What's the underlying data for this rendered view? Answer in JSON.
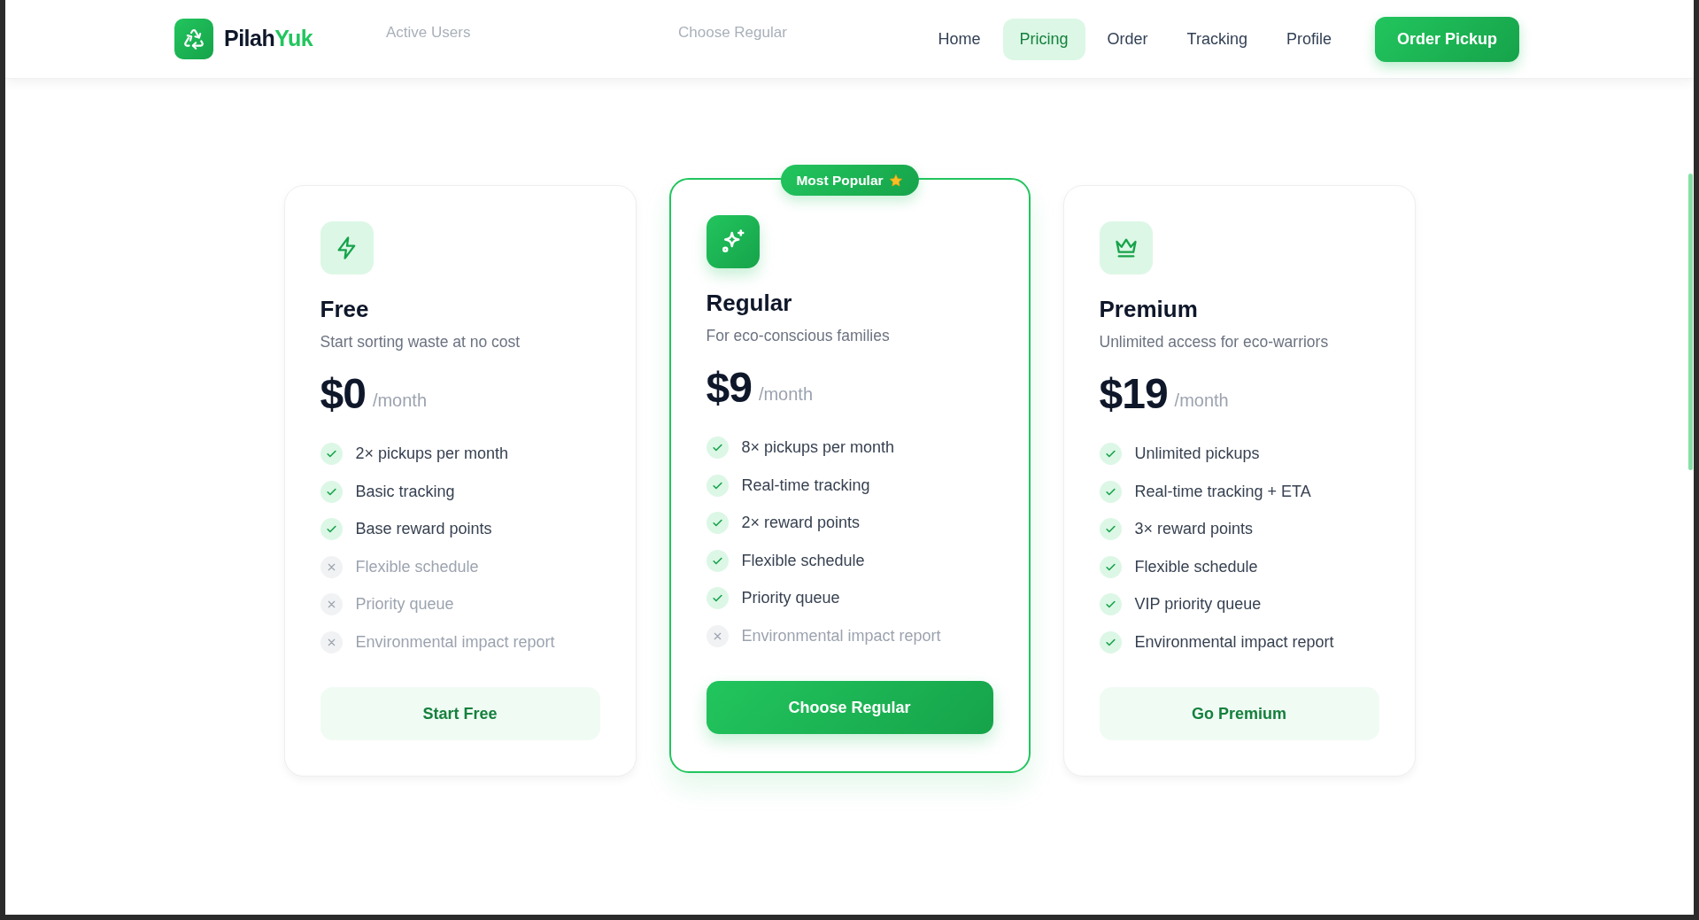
{
  "header": {
    "brand": {
      "first": "Pilah",
      "second": "Yuk"
    },
    "nav": [
      {
        "label": "Home",
        "selected": false
      },
      {
        "label": "Pricing",
        "selected": true
      },
      {
        "label": "Order",
        "selected": false
      },
      {
        "label": "Tracking",
        "selected": false
      },
      {
        "label": "Profile",
        "selected": false
      }
    ],
    "cta": "Order Pickup",
    "background_stats": [
      {
        "label": "Active Users"
      },
      {
        "label": "Choose Regular"
      }
    ]
  },
  "plans": [
    {
      "name": "Free",
      "description": "Start sorting waste at no cost",
      "price": "$0",
      "period": "/month",
      "featured": false,
      "button": "Start Free",
      "features": [
        {
          "text": "2× pickups per month",
          "included": true
        },
        {
          "text": "Basic tracking",
          "included": true
        },
        {
          "text": "Base reward points",
          "included": true
        },
        {
          "text": "Flexible schedule",
          "included": false
        },
        {
          "text": "Priority queue",
          "included": false
        },
        {
          "text": "Environmental impact report",
          "included": false
        }
      ]
    },
    {
      "name": "Regular",
      "description": "For eco-conscious families",
      "price": "$9",
      "period": "/month",
      "featured": true,
      "badge": "Most Popular",
      "button": "Choose Regular",
      "features": [
        {
          "text": "8× pickups per month",
          "included": true
        },
        {
          "text": "Real-time tracking",
          "included": true
        },
        {
          "text": "2× reward points",
          "included": true
        },
        {
          "text": "Flexible schedule",
          "included": true
        },
        {
          "text": "Priority queue",
          "included": true
        },
        {
          "text": "Environmental impact report",
          "included": false
        }
      ]
    },
    {
      "name": "Premium",
      "description": "Unlimited access for eco-warriors",
      "price": "$19",
      "period": "/month",
      "featured": false,
      "button": "Go Premium",
      "features": [
        {
          "text": "Unlimited pickups",
          "included": true
        },
        {
          "text": "Real-time tracking + ETA",
          "included": true
        },
        {
          "text": "3× reward points",
          "included": true
        },
        {
          "text": "Flexible schedule",
          "included": true
        },
        {
          "text": "VIP priority queue",
          "included": true
        },
        {
          "text": "Environmental impact report",
          "included": true
        }
      ]
    }
  ]
}
